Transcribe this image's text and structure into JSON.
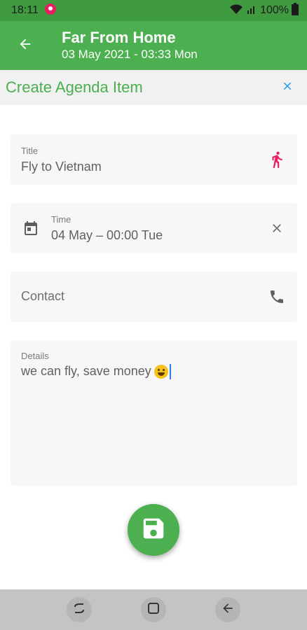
{
  "status_bar": {
    "time": "18:11",
    "battery": "100%"
  },
  "app_bar": {
    "title": "Far From Home",
    "subtitle": "03 May 2021 - 03:33 Mon"
  },
  "section": {
    "title": "Create Agenda Item"
  },
  "form": {
    "title": {
      "caption": "Title",
      "value": "Fly to Vietnam"
    },
    "time": {
      "caption": "Time",
      "value": "04 May – 00:00 Tue"
    },
    "contact": {
      "placeholder": "Contact"
    },
    "details": {
      "caption": "Details",
      "value": "we can fly, save money"
    }
  },
  "colors": {
    "primary": "#4caf50",
    "accent_pink": "#e91e63",
    "close_blue": "#2196f3"
  },
  "icons": {
    "back": "arrow-left-icon",
    "close": "close-icon",
    "title": "running-person-icon",
    "calendar": "calendar-icon",
    "clear": "clear-icon",
    "phone": "phone-icon",
    "save": "save-icon"
  }
}
